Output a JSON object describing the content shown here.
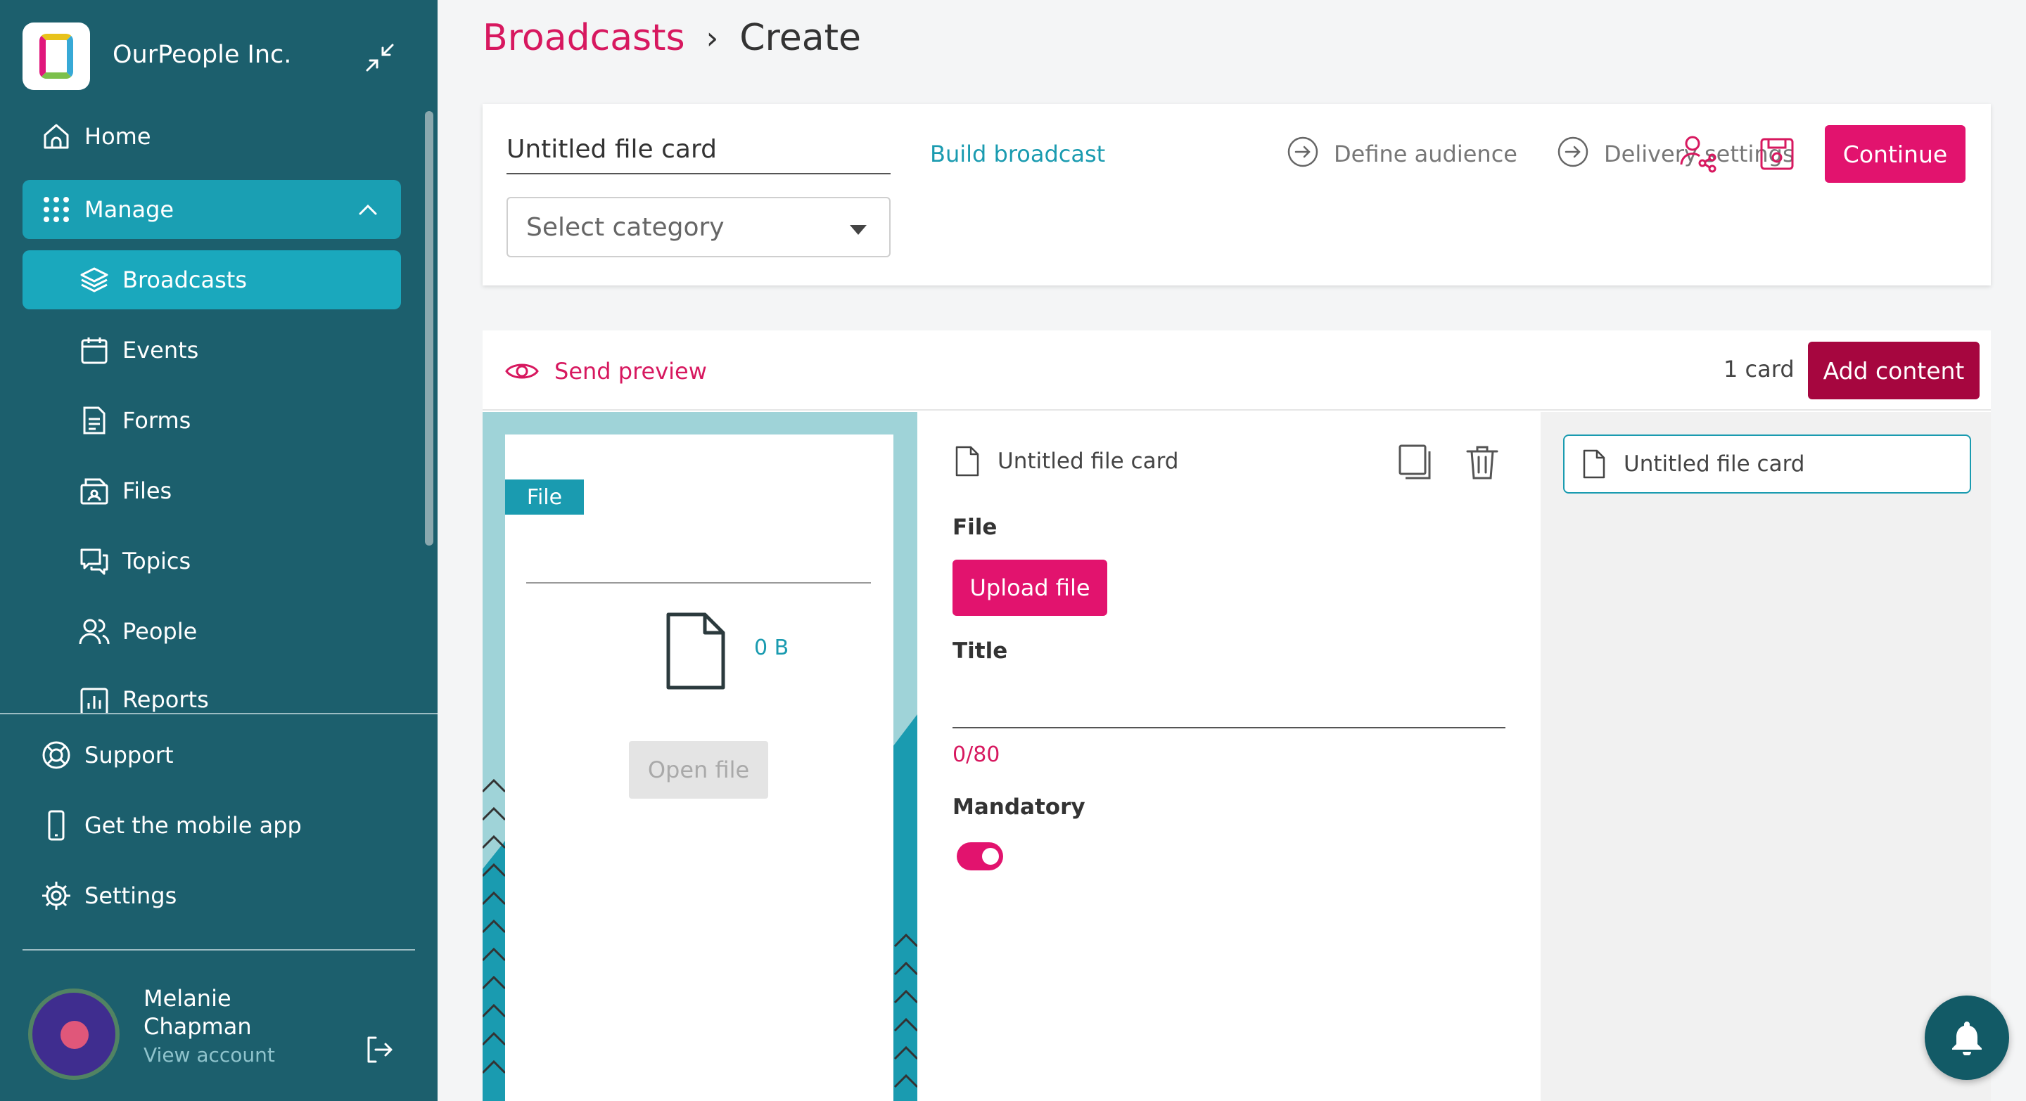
{
  "org": {
    "name": "OurPeople Inc."
  },
  "sidebar": {
    "items": [
      {
        "label": "Home",
        "icon": "home-icon"
      },
      {
        "label": "Manage",
        "icon": "grid-icon"
      },
      {
        "label": "Broadcasts",
        "icon": "layers-icon"
      },
      {
        "label": "Events",
        "icon": "calendar-icon"
      },
      {
        "label": "Forms",
        "icon": "form-icon"
      },
      {
        "label": "Files",
        "icon": "files-icon"
      },
      {
        "label": "Topics",
        "icon": "chat-icon"
      },
      {
        "label": "People",
        "icon": "people-icon"
      },
      {
        "label": "Reports",
        "icon": "reports-icon"
      }
    ],
    "bottom": [
      {
        "label": "Support",
        "icon": "support-icon"
      },
      {
        "label": "Get the mobile app",
        "icon": "phone-icon"
      },
      {
        "label": "Settings",
        "icon": "gear-icon"
      }
    ]
  },
  "user": {
    "name": "Melanie Chapman",
    "link": "View account"
  },
  "breadcrumb": {
    "root": "Broadcasts",
    "current": "Create"
  },
  "editor_top": {
    "name_value": "Untitled file card",
    "category_placeholder": "Select category",
    "steps": [
      "Build broadcast",
      "Define audience",
      "Delivery settings"
    ],
    "continue_label": "Continue"
  },
  "content": {
    "send_preview": "Send preview",
    "card_count": "1 card",
    "add_content": "Add content"
  },
  "preview": {
    "tag": "File",
    "file_size": "0 B",
    "open_file": "Open file"
  },
  "card_editor": {
    "card_title": "Untitled file card",
    "file_label": "File",
    "upload_label": "Upload file",
    "title_label": "Title",
    "title_value": "",
    "counter": "0/80",
    "mandatory_label": "Mandatory",
    "mandatory_on": true
  },
  "outline": {
    "items": [
      "Untitled file card"
    ]
  },
  "colors": {
    "sidebar": "#1c5f6d",
    "accent": "#e2136e",
    "teal": "#1a9bb0",
    "dark_accent": "#a6063f"
  }
}
